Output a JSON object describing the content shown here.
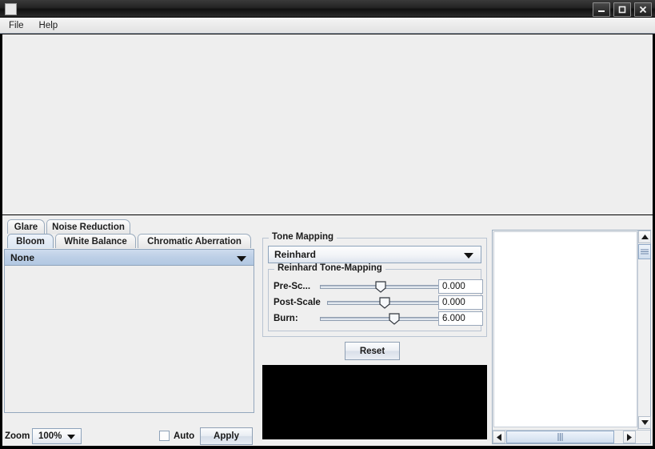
{
  "window": {
    "title": "",
    "controls": [
      {
        "name": "minimize-button",
        "glyph": "minimize-icon"
      },
      {
        "name": "maximize-button",
        "glyph": "maximize-icon"
      },
      {
        "name": "close-button",
        "glyph": "close-icon"
      }
    ]
  },
  "menubar": {
    "items": [
      {
        "label": "File"
      },
      {
        "label": "Help"
      }
    ]
  },
  "left_panel": {
    "tabs_row1": [
      {
        "label": "Glare",
        "selected": false
      },
      {
        "label": "Noise Reduction",
        "selected": false
      }
    ],
    "tabs_row2": [
      {
        "label": "Bloom",
        "selected": true
      },
      {
        "label": "White Balance",
        "selected": false
      },
      {
        "label": "Chromatic Aberration",
        "selected": false
      }
    ],
    "bloom_combo": {
      "value": "None",
      "options": [
        "None"
      ]
    }
  },
  "tone_mapping": {
    "group_title": "Tone Mapping",
    "operator_combo": {
      "value": "Reinhard",
      "options": [
        "Reinhard"
      ]
    },
    "inner_group_title": "Reinhard Tone-Mapping",
    "sliders": [
      {
        "label": "Pre-Sc...",
        "value": "0.000",
        "percent": 50
      },
      {
        "label": "Post-Scale",
        "value": "0.000",
        "percent": 50
      },
      {
        "label": "Burn:",
        "value": "6.000",
        "percent": 61
      }
    ],
    "reset_label": "Reset"
  },
  "statusbar": {
    "zoom_label": "Zoom",
    "zoom_combo": {
      "value": "100%",
      "options": [
        "100%"
      ]
    },
    "auto_label": "Auto",
    "auto_checked": false,
    "apply_label": "Apply"
  },
  "colors": {
    "window_bg": "#efefef",
    "preview_bg": "#eeeeee",
    "black_preview": "#000000",
    "selection_blue": "#bccfe6",
    "border_blue": "#93a7bd"
  }
}
